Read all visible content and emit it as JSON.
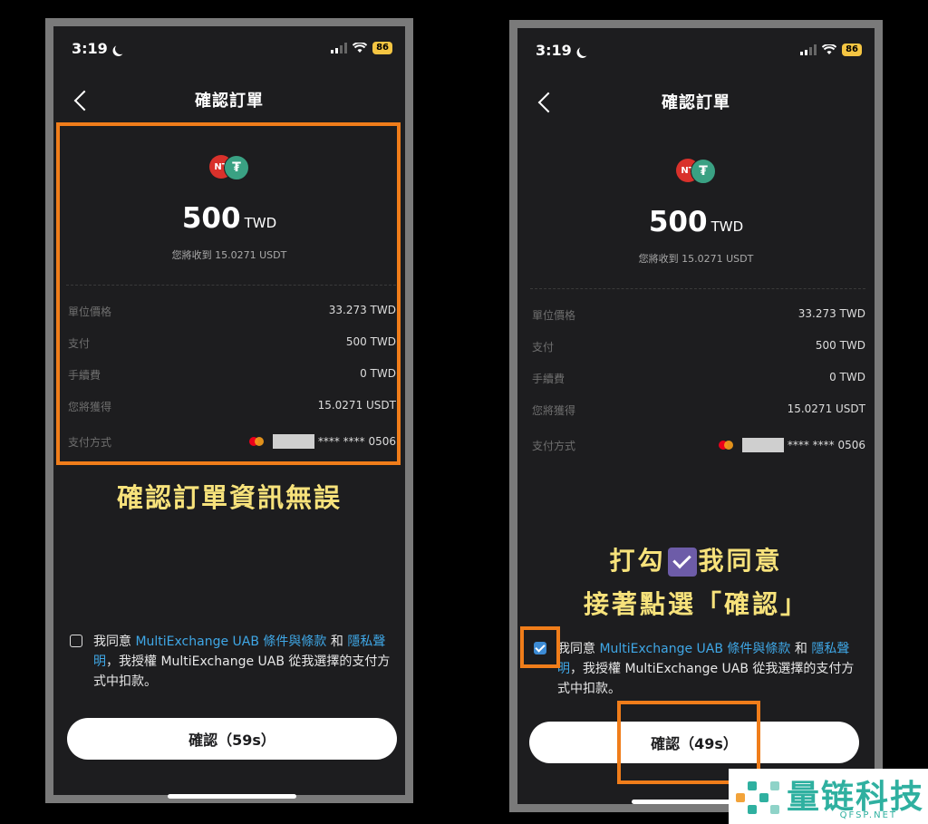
{
  "left": {
    "status": {
      "time": "3:19",
      "battery": "86"
    },
    "title": "確認訂單",
    "coins": {
      "nt": "NT",
      "usdt": "₮"
    },
    "amount": {
      "value": "500",
      "currency": "TWD"
    },
    "receive": "您將收到 15.0271 USDT",
    "rows": [
      {
        "label": "單位價格",
        "value": "33.273 TWD"
      },
      {
        "label": "支付",
        "value": "500 TWD"
      },
      {
        "label": "手續費",
        "value": "0 TWD"
      },
      {
        "label": "您將獲得",
        "value": "15.0271 USDT"
      },
      {
        "label": "支付方式",
        "value": "**** **** 0506"
      }
    ],
    "annotation": "確認訂單資訊無誤",
    "agree": {
      "prefix": "我同意 ",
      "link1": "MultiExchange UAB 條件與條款",
      "mid": " 和 ",
      "link2": "隱私聲明",
      "suffix": "，我授權 MultiExchange UAB 從我選擇的支付方式中扣款。"
    },
    "button": "確認（59s）"
  },
  "right": {
    "status": {
      "time": "3:19",
      "battery": "86"
    },
    "title": "確認訂單",
    "coins": {
      "nt": "NT",
      "usdt": "₮"
    },
    "amount": {
      "value": "500",
      "currency": "TWD"
    },
    "receive": "您將收到 15.0271 USDT",
    "rows": [
      {
        "label": "單位價格",
        "value": "33.273 TWD"
      },
      {
        "label": "支付",
        "value": "500 TWD"
      },
      {
        "label": "手續費",
        "value": "0 TWD"
      },
      {
        "label": "您將獲得",
        "value": "15.0271 USDT"
      },
      {
        "label": "支付方式",
        "value": "**** **** 0506"
      }
    ],
    "annotation1a": "打勾",
    "annotation1b": "我同意",
    "annotation2": "接著點選「確認」",
    "agree": {
      "prefix": "我同意 ",
      "link1": "MultiExchange UAB 條件與條款",
      "mid": " 和 ",
      "link2": "隱私聲明",
      "suffix": "，我授權 MultiExchange UAB 從我選擇的支付方式中扣款。"
    },
    "button": "確認（49s）"
  },
  "watermark": {
    "name": "量链科技",
    "domain": "QFSP.NET"
  },
  "colors": {
    "highlight": "#f07d1a",
    "annotation": "#f7e27b",
    "link": "#3fa7e6",
    "checkbox": "#3d8bd4"
  }
}
